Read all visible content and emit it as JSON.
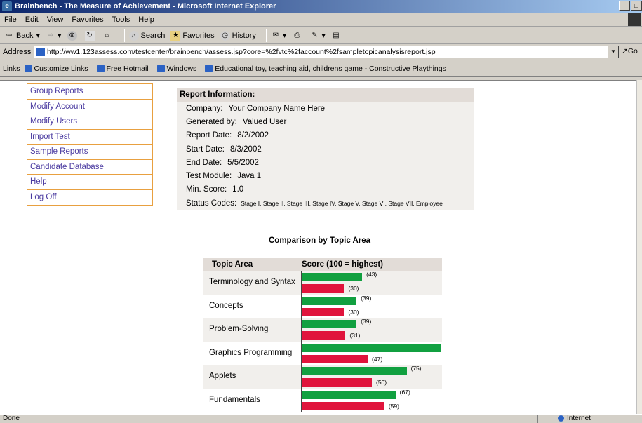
{
  "window": {
    "title": "Brainbench - The Measure of Achievement - Microsoft Internet Explorer",
    "controls": [
      "_",
      "□"
    ]
  },
  "menu": [
    "File",
    "Edit",
    "View",
    "Favorites",
    "Tools",
    "Help"
  ],
  "toolbar": {
    "back": "Back",
    "search": "Search",
    "favorites": "Favorites",
    "history": "History"
  },
  "address": {
    "label": "Address",
    "url": "http://ww1.123assess.com/testcenter/brainbench/assess.jsp?core=%2fvtc%2faccount%2fsampletopicanalysisreport.jsp",
    "go": "Go"
  },
  "links": {
    "label": "Links",
    "items": [
      "Customize Links",
      "Free Hotmail",
      "Windows",
      "Educational toy, teaching aid, childrens game - Constructive Playthings"
    ]
  },
  "nav": {
    "items": [
      "Group Reports",
      "Modify Account",
      "Modify Users",
      "Import Test",
      "Sample Reports",
      "Candidate Database",
      "Help",
      "Log Off"
    ]
  },
  "report": {
    "header": "Report Information:",
    "rows": [
      {
        "label": "Company:",
        "value": "Your Company Name Here"
      },
      {
        "label": "Generated by:",
        "value": "Valued User"
      },
      {
        "label": "Report Date:",
        "value": "8/2/2002"
      },
      {
        "label": "Start Date:",
        "value": "8/3/2002"
      },
      {
        "label": "End Date:",
        "value": "5/5/2002"
      },
      {
        "label": "Test Module:",
        "value": "Java 1"
      },
      {
        "label": "Min. Score:",
        "value": "1.0"
      },
      {
        "label": "Status Codes:",
        "value": "Stage I, Stage II, Stage III, Stage IV, Stage V, Stage VI, Stage VII, Employee"
      }
    ]
  },
  "chart_data": {
    "type": "bar",
    "title": "Comparison by Topic Area",
    "column_headers": [
      "Topic Area",
      "Score (100 = highest)"
    ],
    "categories": [
      "Terminology and Syntax",
      "Concepts",
      "Problem-Solving",
      "Graphics Programming",
      "Applets",
      "Fundamentals"
    ],
    "series": [
      {
        "values": [
          43,
          39,
          39,
          100,
          75,
          67
        ],
        "labels": [
          "(43)",
          "(39)",
          "(39)",
          "",
          "(75)",
          "(67)"
        ],
        "color": "#11a040"
      },
      {
        "values": [
          30,
          30,
          31,
          47,
          50,
          59
        ],
        "labels": [
          "(30)",
          "(30)",
          "(31)",
          "(47)",
          "(50)",
          "(59)"
        ],
        "color": "#e0143c"
      }
    ],
    "ylim": [
      0,
      100
    ]
  },
  "status": {
    "left": "Done",
    "zone": "Internet"
  }
}
